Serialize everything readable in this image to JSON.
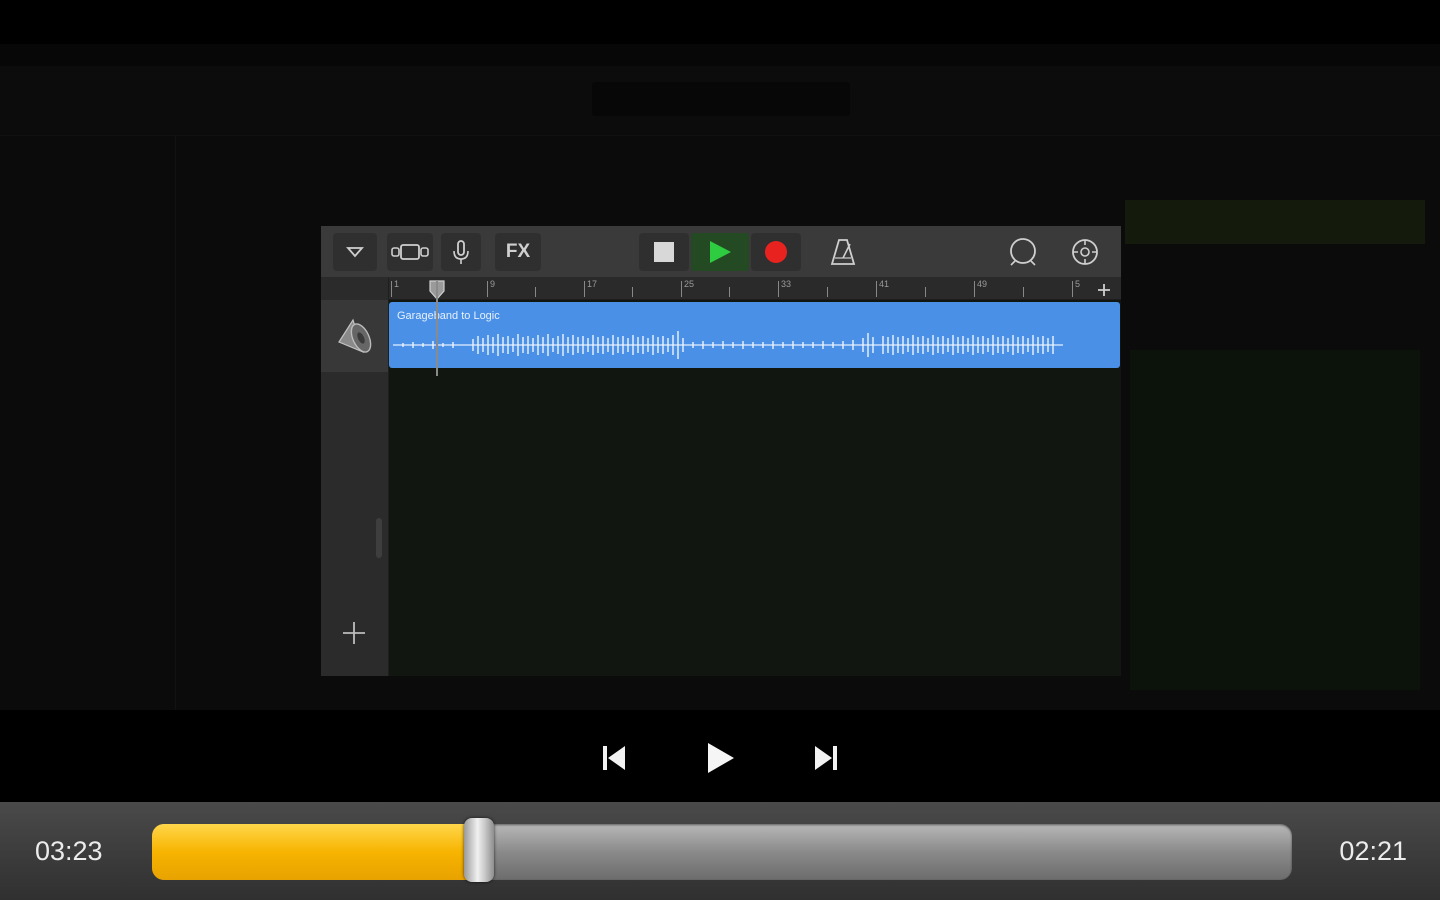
{
  "player": {
    "elapsed": "03:23",
    "remaining": "02:21",
    "progress": 0.287,
    "accent_color": "#f7b400"
  },
  "controls": {
    "previous_icon": "skip-previous-icon",
    "play_icon": "play-icon",
    "next_icon": "skip-next-icon"
  },
  "garageband": {
    "toolbar": {
      "fx_label": "FX",
      "icons": [
        "dropdown-triangle-icon",
        "tracks-view-icon",
        "microphone-icon",
        "stop-icon",
        "play-icon",
        "record-icon",
        "metronome-icon",
        "loop-icon",
        "settings-icon"
      ]
    },
    "ruler_labels": [
      "1",
      "9",
      "17",
      "25",
      "33",
      "41",
      "49",
      "5"
    ],
    "region": {
      "name": "Garageband to Logic",
      "color": "#4a90e6"
    }
  }
}
